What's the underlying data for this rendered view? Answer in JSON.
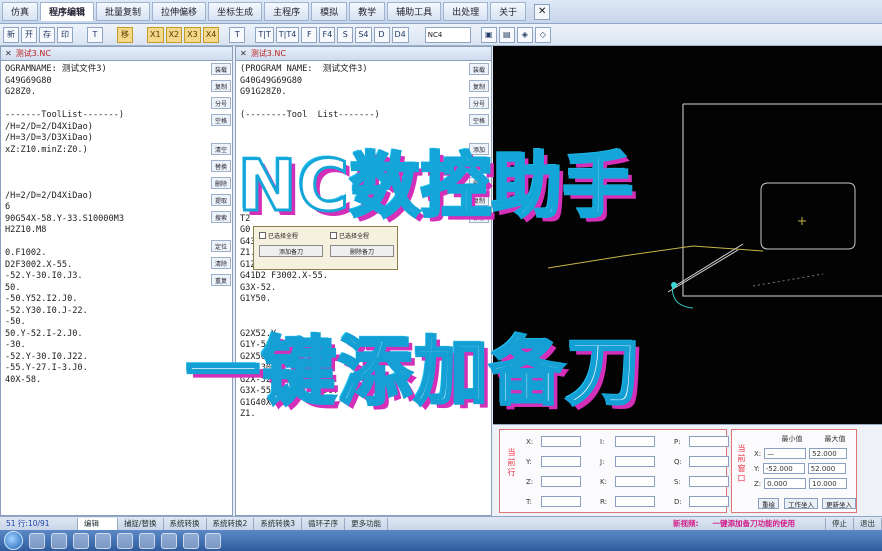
{
  "menu": {
    "items": [
      "仿真",
      "程序编辑",
      "批量复制",
      "拉伸偏移",
      "坐标生成",
      "主程序",
      "模拟",
      "教学",
      "辅助工具",
      "出处理",
      "关于"
    ],
    "close_label": "✕"
  },
  "toolbar": {
    "buttons": [
      "新",
      "开",
      "存",
      "印",
      "T",
      "移",
      "X1",
      "X2",
      "X3",
      "X4",
      "T",
      "T|T",
      "T|T4",
      "F",
      "F4",
      "S",
      "S4",
      "D",
      "D4"
    ],
    "select_value": "NC4"
  },
  "left_panel": {
    "tab_label": "测试3.NC",
    "lines": [
      "OGRAMNAME: 测试文件3)",
      "G49G69G80",
      "G28Z0.",
      "",
      "-------ToolList-------)",
      "/H=2/D=2/D4XiDao)",
      "/H=3/D=3/D3XiDao)",
      "xZ:Z10.minZ:Z0.)",
      "",
      "",
      "",
      "/H=2/D=2/D4XiDao)",
      "6",
      "90G54X-58.Y-33.S10000M3",
      "H2Z10.M8",
      "",
      "0.F1002.",
      "D2F3002.X-55.",
      "-52.Y-30.I0.J3.",
      "50.",
      "-50.Y52.I2.J0.",
      "-52.Y30.I0.J-22.",
      "-50.",
      "50.Y-52.I-2.J0.",
      "-30.",
      "-52.Y-30.I0.J22.",
      "-55.Y-27.I-3.J0.",
      "40X-58."
    ],
    "side_buttons": [
      "装载",
      "复制",
      "分号",
      "空格",
      "清空",
      "替换",
      "删除",
      "提取",
      "搜索",
      "定位",
      "清除",
      "重复"
    ]
  },
  "mid_panel": {
    "tab_label": "测试3.NC",
    "lines": [
      "(PROGRAM NAME:  测试文件3)",
      "G40G49G69G80",
      "G91G28Z0.",
      "",
      "(--------Tool  List-------)",
      "",
      "",
      "",
      "",
      "",
      "",
      "",
      "",
      "T2",
      "G0",
      "G43H2Z10.M8",
      "Z1.",
      "G1Z0.F1002.",
      "G41D2 F3002.X-55.",
      "G3X-52.",
      "G1Y50.",
      "",
      "",
      "G2X52.Y",
      "G1Y-50.",
      "G2X50.Y-52.I-2.J0.",
      "G1X-30.",
      "G2X-52.Y-30.I0.J22.",
      "G3X-55.Y-27.I-3.J0.",
      "G1G40X-58.",
      "Z1."
    ],
    "side_buttons": [
      "装载",
      "复制",
      "分号",
      "空格",
      "添加",
      "替换",
      "删除",
      "复制",
      "保存"
    ]
  },
  "dialog": {
    "check_1": "已选择全程",
    "check_2": "已选择全程",
    "button_1": "添加备刀",
    "button_2": "删除备刀"
  },
  "readout": {
    "left_title": "当前行",
    "right_title": "当前窗口",
    "axes_col1": [
      "X:",
      "Y:",
      "Z:",
      "T:"
    ],
    "axes_col2": [
      "I:",
      "J:",
      "K:",
      "R:"
    ],
    "axes_col3": [
      "P:",
      "Q:",
      "S:",
      "D:"
    ],
    "min_header": "最小值",
    "max_header": "最大值",
    "x_min": "—",
    "x_max": "52.000",
    "y_min": "-52.000",
    "y_max": "52.000",
    "z_min": "0.000",
    "z_max": "10.000",
    "btn_1": "重绘",
    "btn_2": "工作坐入",
    "btn_3": "更新坐入"
  },
  "status": {
    "position": "51 行:10/91",
    "tabs": [
      "编辑",
      "捕捉/替换",
      "系统转换",
      "系统转换2",
      "系统转换3",
      "循环子序",
      "更多功能"
    ],
    "hint_prefix": "新视频:",
    "hint_text": "一键添加备刀功能的使用",
    "stop_label": "停止",
    "exit_label": "退出"
  },
  "overlay": {
    "title_1": "NC数控助手",
    "title_2": "一键添加备刀"
  },
  "colors": {
    "overlay_stroke": "#15a6d9",
    "overlay_shadow": "#d42fb8",
    "toolpath_white": "#d8d8d8",
    "toolpath_yellow": "#c8b44a",
    "toolpath_cyan": "#3fd5d5"
  }
}
